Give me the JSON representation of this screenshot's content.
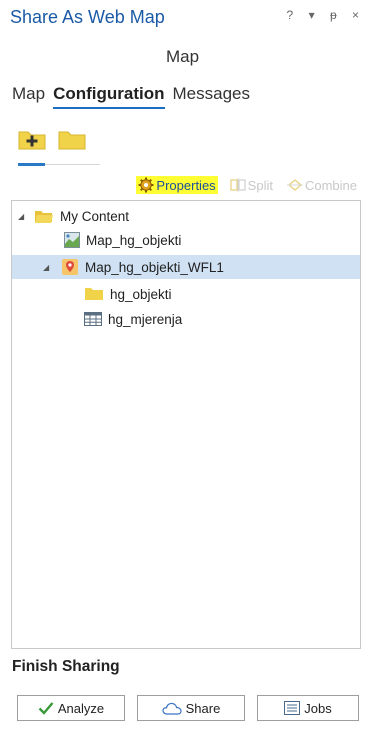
{
  "window": {
    "title": "Share As Web Map",
    "controls": [
      "?",
      "▾",
      "ᵽ",
      "×"
    ],
    "subtitle": "Map"
  },
  "tabs": [
    {
      "label": "Map",
      "active": false
    },
    {
      "label": "Configuration",
      "active": true
    },
    {
      "label": "Messages",
      "active": false
    }
  ],
  "toolbar": {
    "properties_label": "Properties",
    "split_label": "Split",
    "combine_label": "Combine"
  },
  "tree": {
    "items": [
      {
        "label": "My Content",
        "icon": "folder-open-icon",
        "level": 0,
        "expanded": true
      },
      {
        "label": "Map_hg_objekti",
        "icon": "web-map-icon",
        "level": 1
      },
      {
        "label": "Map_hg_objekti_WFL1",
        "icon": "feature-layer-icon",
        "level": 1,
        "expanded": true,
        "selected": true
      },
      {
        "label": "hg_objekti",
        "icon": "folder-icon",
        "level": 2
      },
      {
        "label": "hg_mjerenja",
        "icon": "table-icon",
        "level": 2
      }
    ]
  },
  "finish": {
    "heading": "Finish Sharing",
    "analyze_label": "Analyze",
    "share_label": "Share",
    "jobs_label": "Jobs"
  },
  "colors": {
    "title": "#1b5aa6",
    "accent": "#2a79c6",
    "highlight": "#ffff33",
    "selected": "#cfe1f3",
    "folder": "#f1d34a"
  }
}
